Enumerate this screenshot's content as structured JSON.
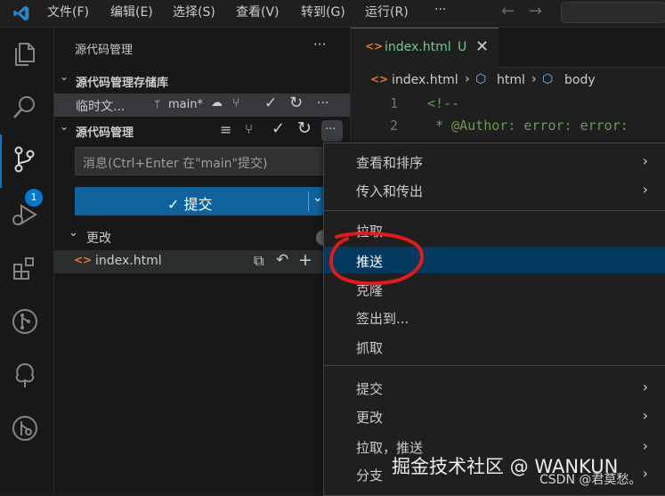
{
  "menubar": {
    "items": [
      "文件(F)",
      "编辑(E)",
      "选择(S)",
      "查看(V)",
      "转到(G)",
      "运行(R)",
      "···"
    ]
  },
  "activity": {
    "badge": "1"
  },
  "sidebar": {
    "title": "源代码管理",
    "more": "···",
    "repos_section": "源代码管理存储库",
    "repo_name": "临时文...",
    "branch": "main*",
    "scm_section": "源代码管理",
    "commit_placeholder": "消息(Ctrl+Enter 在\"main\"提交)",
    "commit_button": "✓ 提交",
    "changes_label": "更改",
    "file_name": "index.html"
  },
  "editor": {
    "tab_label": "index.html",
    "tab_status": "U",
    "breadcrumb": [
      "index.html",
      "html",
      "body"
    ],
    "lines": [
      {
        "num": "1",
        "text": "<!--"
      },
      {
        "num": "2",
        "text": " * @Author: error: error:"
      }
    ]
  },
  "context_menu": {
    "items": [
      {
        "label": "查看和排序",
        "submenu": true
      },
      {
        "label": "传入和传出",
        "submenu": true
      },
      {
        "label": "拉取",
        "submenu": false
      },
      {
        "label": "推送",
        "submenu": false,
        "highlighted": true
      },
      {
        "label": "克隆",
        "submenu": false
      },
      {
        "label": "签出到...",
        "submenu": false
      },
      {
        "label": "抓取",
        "submenu": false
      },
      {
        "label": "提交",
        "submenu": true
      },
      {
        "label": "更改",
        "submenu": true
      },
      {
        "label": "拉取，推送",
        "submenu": true
      },
      {
        "label": "分支",
        "submenu": true
      }
    ]
  },
  "watermark": {
    "juejin": "掘金技术社区 @ WANKUN",
    "csdn": "CSDN @君莫愁。"
  },
  "colors": {
    "accent": "#0078d4",
    "highlight": "#04395e",
    "annotation": "#e01b1b"
  }
}
